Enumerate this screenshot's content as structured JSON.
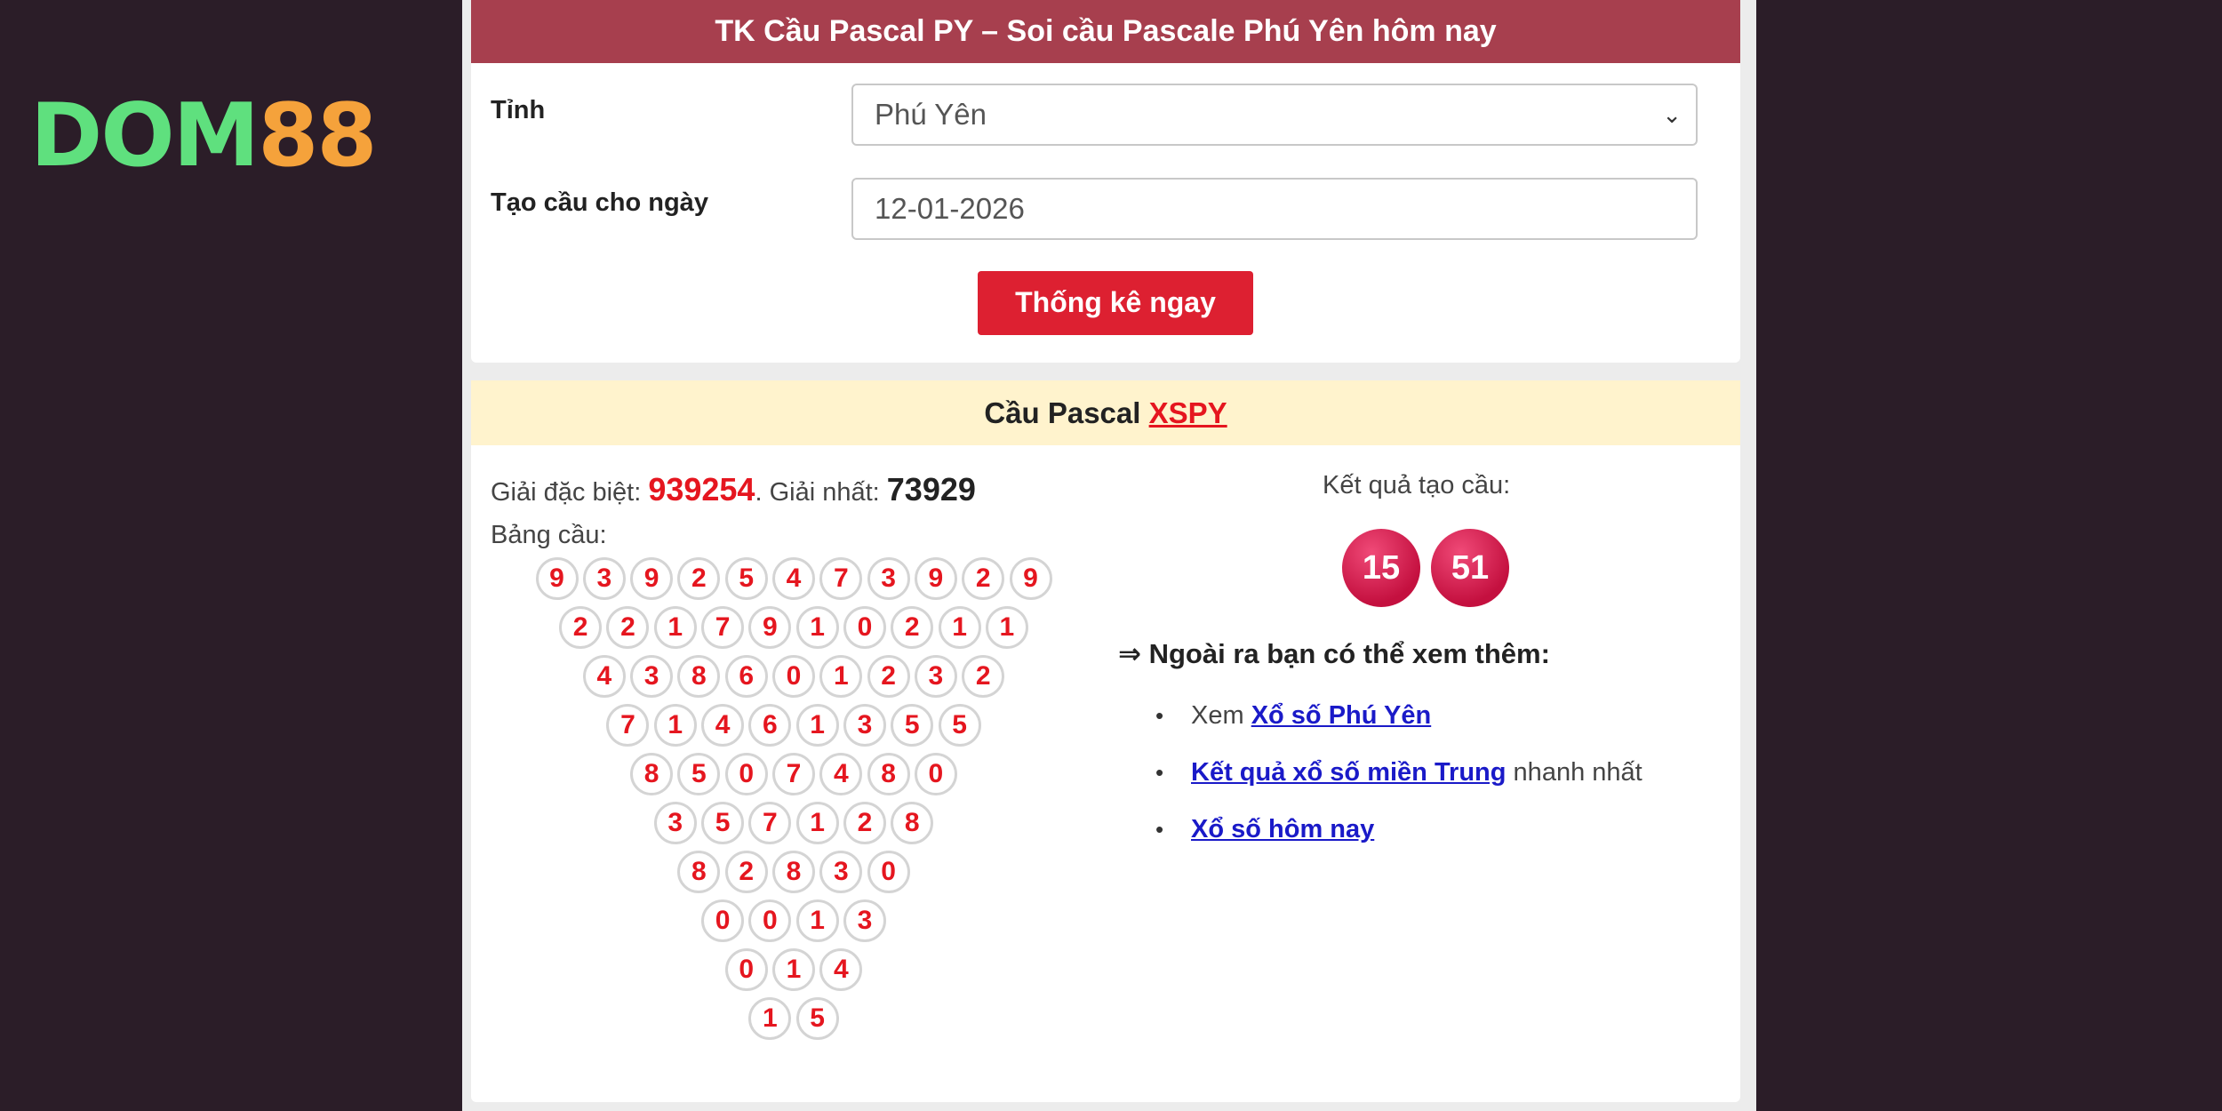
{
  "logo": {
    "part1": "DOM",
    "part2": "88"
  },
  "form": {
    "title": "TK Cầu Pascal PY – Soi cầu Pascale Phú Yên hôm nay",
    "province_label": "Tỉnh",
    "province_value": "Phú Yên",
    "date_label": "Tạo cầu cho ngày",
    "date_value": "12-01-2026",
    "submit_label": "Thống kê ngay"
  },
  "result": {
    "header_prefix": "Cầu Pascal ",
    "header_link": "XSPY",
    "special_label": "Giải đặc biệt: ",
    "special_value": "939254",
    "sep": ". ",
    "first_label": "Giải nhất: ",
    "first_value": "73929",
    "table_label": "Bảng cầu:",
    "pascal_rows": [
      [
        "9",
        "3",
        "9",
        "2",
        "5",
        "4",
        "7",
        "3",
        "9",
        "2",
        "9"
      ],
      [
        "2",
        "2",
        "1",
        "7",
        "9",
        "1",
        "0",
        "2",
        "1",
        "1"
      ],
      [
        "4",
        "3",
        "8",
        "6",
        "0",
        "1",
        "2",
        "3",
        "2"
      ],
      [
        "7",
        "1",
        "4",
        "6",
        "1",
        "3",
        "5",
        "5"
      ],
      [
        "8",
        "5",
        "0",
        "7",
        "4",
        "8",
        "0"
      ],
      [
        "3",
        "5",
        "7",
        "1",
        "2",
        "8"
      ],
      [
        "8",
        "2",
        "8",
        "3",
        "0"
      ],
      [
        "0",
        "0",
        "1",
        "3"
      ],
      [
        "0",
        "1",
        "4"
      ],
      [
        "1",
        "5"
      ]
    ],
    "kq_label": "Kết quả tạo cầu:",
    "kq_values": [
      "15",
      "51"
    ]
  },
  "more": {
    "title": "⇒ Ngoài ra bạn có thể xem thêm:",
    "bullet": "•",
    "items": [
      {
        "prefix": "Xem ",
        "link": "Xổ số Phú Yên",
        "suffix": ""
      },
      {
        "prefix": "",
        "link": "Kết quả xổ số miền Trung",
        "suffix": " nhanh nhất"
      },
      {
        "prefix": "",
        "link": "Xổ số hôm nay",
        "suffix": ""
      }
    ]
  },
  "colors": {
    "header": "#a73f4e",
    "button": "#dd2031",
    "accent_red": "#e5161f",
    "link": "#1a1ac8",
    "band": "#fff3cd"
  },
  "icons": {
    "select_arrow": "chevron-down-icon"
  }
}
